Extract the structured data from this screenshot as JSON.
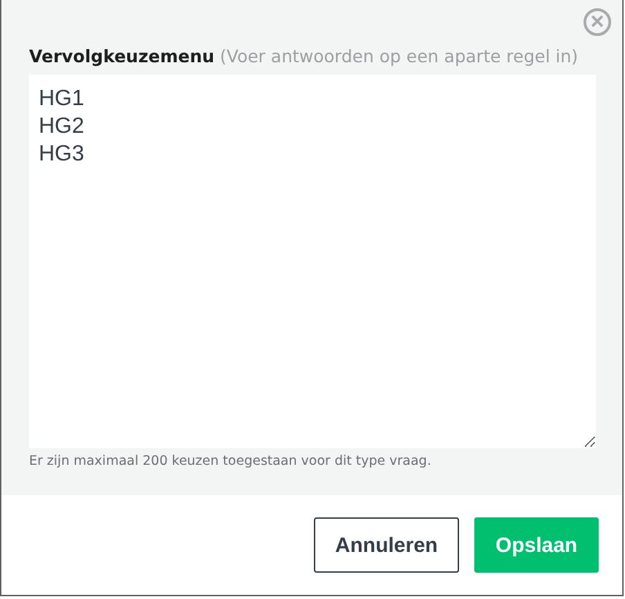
{
  "dialog": {
    "close_button": {
      "glyph": "×"
    },
    "field": {
      "label": "Vervolgkeuzemenu",
      "hint": "(Voer antwoorden op een aparte regel in)",
      "value": "HG1\nHG2\nHG3"
    },
    "help_text": "Er zijn maximaal 200 keuzen toegestaan voor dit type vraag.",
    "buttons": [
      {
        "label": "Annuleren",
        "kind": "secondary"
      },
      {
        "label": "Opslaan",
        "kind": "primary"
      }
    ]
  }
}
